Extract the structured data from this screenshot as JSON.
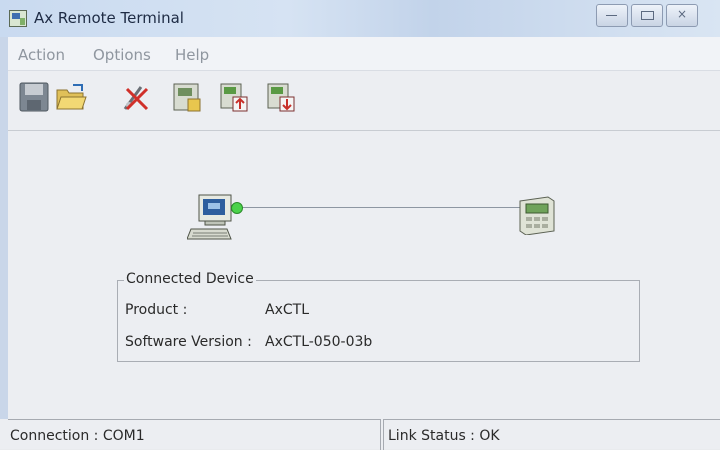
{
  "window": {
    "title": "Ax Remote Terminal"
  },
  "menu": {
    "items": [
      "Action",
      "Options",
      "Help"
    ]
  },
  "toolbar": {
    "icons": [
      "save-icon",
      "open-folder-icon",
      "disconnect-icon",
      "device-config-icon",
      "upload-icon",
      "download-icon"
    ]
  },
  "device": {
    "group_title": "Connected Device",
    "product_label": "Product :",
    "product_value": "AxCTL",
    "software_label": "Software Version :",
    "software_value": "AxCTL-050-03b"
  },
  "status": {
    "connection": "Connection : COM1",
    "link": "Link Status : OK"
  },
  "colors": {
    "link_dot": "#4bd24b",
    "titlebar": "#c9daf0"
  }
}
